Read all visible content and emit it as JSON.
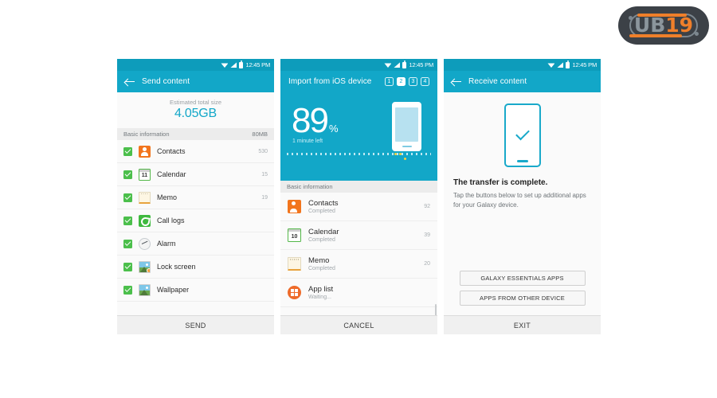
{
  "logo": {
    "part1": "UB",
    "part2": "19",
    "name": "ub19-logo"
  },
  "status_bar": {
    "time": "12:45 PM",
    "wifi": "wifi-icon",
    "signal": "signal-icon",
    "battery": "battery-icon"
  },
  "colors": {
    "teal_header": "#12a7c8",
    "teal_status": "#0d9cbb",
    "green_check": "#4bbf4b",
    "orange": "#f2751d",
    "yellow_dot": "#f7d33c"
  },
  "screen1": {
    "title": "Send content",
    "back": "back-arrow-icon",
    "total_label": "Estimated total size",
    "total_value": "4.05GB",
    "section_label": "Basic information",
    "section_size": "80MB",
    "items": [
      {
        "label": "Contacts",
        "count": "530",
        "icon": "contacts-icon",
        "checked": true
      },
      {
        "label": "Calendar",
        "count": "15",
        "icon": "calendar-icon",
        "checked": true,
        "day": "11"
      },
      {
        "label": "Memo",
        "count": "19",
        "icon": "memo-icon",
        "checked": true
      },
      {
        "label": "Call logs",
        "count": "",
        "icon": "call-logs-icon",
        "checked": true
      },
      {
        "label": "Alarm",
        "count": "",
        "icon": "alarm-icon",
        "checked": true
      },
      {
        "label": "Lock screen",
        "count": "",
        "icon": "lock-screen-icon",
        "checked": true
      },
      {
        "label": "Wallpaper",
        "count": "",
        "icon": "wallpaper-icon",
        "checked": true
      }
    ],
    "action": "SEND"
  },
  "screen2": {
    "title": "Import from iOS device",
    "back": "",
    "steps": [
      {
        "label": "1",
        "active": false
      },
      {
        "label": "2",
        "active": true
      },
      {
        "label": "3",
        "active": false
      },
      {
        "label": "4",
        "active": false
      }
    ],
    "percent": "89",
    "percent_symbol": "%",
    "time_left": "1 minute left",
    "section_label": "Basic information",
    "items": [
      {
        "label": "Contacts",
        "status": "Completed",
        "count": "92",
        "icon": "contacts-icon"
      },
      {
        "label": "Calendar",
        "status": "Completed",
        "count": "39",
        "icon": "calendar-icon",
        "day": "10"
      },
      {
        "label": "Memo",
        "status": "Completed",
        "count": "20",
        "icon": "memo-icon"
      },
      {
        "label": "App list",
        "status": "Waiting...",
        "count": "",
        "icon": "app-list-icon"
      }
    ],
    "action": "CANCEL"
  },
  "screen3": {
    "title": "Receive content",
    "back": "back-arrow-icon",
    "illustration": "phone-with-checkmark-icon",
    "headline": "The transfer is complete.",
    "description": "Tap the buttons below to set up additional apps for your Galaxy device.",
    "buttons": [
      {
        "label": "GALAXY ESSENTIALS APPS"
      },
      {
        "label": "APPS FROM OTHER DEVICE"
      }
    ],
    "action": "EXIT"
  }
}
